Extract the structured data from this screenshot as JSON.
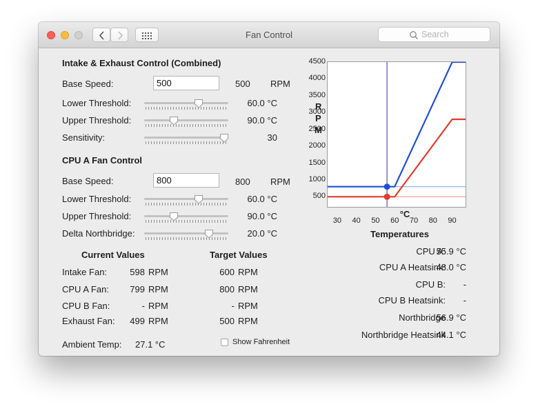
{
  "window": {
    "title": "Fan Control",
    "search_placeholder": "Search",
    "toolbar_icons": [
      "back-arrow-icon",
      "forward-arrow-icon",
      "grid-icon",
      "search-icon"
    ]
  },
  "intake": {
    "heading": "Intake & Exhaust Control (Combined)",
    "base_speed_label": "Base Speed:",
    "base_speed_input": "500",
    "base_speed_value": "500",
    "base_speed_unit": "RPM",
    "lower_label": "Lower Threshold:",
    "lower_value": "60.0 °C",
    "lower_slider_fraction": 0.65,
    "upper_label": "Upper Threshold:",
    "upper_value": "90.0 °C",
    "upper_slider_fraction": 0.35,
    "sensitivity_label": "Sensitivity:",
    "sensitivity_value": "30",
    "sensitivity_slider_fraction": 0.95
  },
  "cpu_a": {
    "heading": "CPU A Fan Control",
    "base_speed_label": "Base Speed:",
    "base_speed_input": "800",
    "base_speed_value": "800",
    "base_speed_unit": "RPM",
    "lower_label": "Lower Threshold:",
    "lower_value": "60.0 °C",
    "lower_slider_fraction": 0.65,
    "upper_label": "Upper Threshold:",
    "upper_value": "90.0 °C",
    "upper_slider_fraction": 0.35,
    "delta_label": "Delta Northbridge:",
    "delta_value": "20.0 °C",
    "delta_slider_fraction": 0.77
  },
  "values": {
    "current_heading": "Current Values",
    "target_heading": "Target Values",
    "rows": [
      {
        "label": "Intake Fan:",
        "current": "598",
        "current_unit": "RPM",
        "target": "600",
        "target_unit": "RPM"
      },
      {
        "label": "CPU A Fan:",
        "current": "799",
        "current_unit": "RPM",
        "target": "800",
        "target_unit": "RPM"
      },
      {
        "label": "CPU B Fan:",
        "current": "-",
        "current_unit": "RPM",
        "target": "-",
        "target_unit": "RPM"
      },
      {
        "label": "Exhaust Fan:",
        "current": "499",
        "current_unit": "RPM",
        "target": "500",
        "target_unit": "RPM"
      }
    ],
    "ambient_label": "Ambient Temp:",
    "ambient_value": "27.1 °C",
    "fahrenheit_label": "Show Fahrenheit",
    "fahrenheit_checked": false
  },
  "temperatures": {
    "heading": "Temperatures",
    "rows": [
      {
        "label": "CPU A:",
        "value": "55.9 °C"
      },
      {
        "label": "CPU A Heatsink:",
        "value": "48.0 °C"
      },
      {
        "label": "CPU B:",
        "value": "-"
      },
      {
        "label": "CPU B Heatsink:",
        "value": "-"
      },
      {
        "label": "Northbridge",
        "value": "56.9 °C"
      },
      {
        "label": "Northbridge Heatsink",
        "value": "44.1 °C"
      }
    ]
  },
  "chart_data": {
    "type": "line",
    "ylabel": "RPM",
    "xlabel": "°C",
    "xlim": [
      25,
      97
    ],
    "ylim": [
      200,
      4500
    ],
    "x_ticks": [
      30,
      40,
      50,
      60,
      70,
      80,
      90
    ],
    "y_ticks": [
      500,
      1000,
      1500,
      2000,
      2500,
      3000,
      3500,
      4000,
      4500
    ],
    "colors": {
      "blue": "#1f4fcf",
      "red": "#de3c2e",
      "light_blue": "#8aaaf2",
      "light_red": "#f0a39b",
      "marker_line": "#5a4aa8"
    },
    "series": [
      {
        "color": "blue",
        "x": [
          25,
          60,
          90,
          97
        ],
        "y": [
          800,
          800,
          4500,
          4500
        ]
      },
      {
        "color": "red",
        "x": [
          25,
          60,
          90,
          97
        ],
        "y": [
          500,
          500,
          2800,
          2800
        ]
      }
    ],
    "reference_lines": [
      {
        "color": "light_blue",
        "y": 800
      },
      {
        "color": "light_red",
        "y": 500
      }
    ],
    "current_temp": 56,
    "markers": [
      {
        "color": "blue",
        "x": 56,
        "y": 800
      },
      {
        "color": "red",
        "x": 56,
        "y": 500
      }
    ]
  }
}
